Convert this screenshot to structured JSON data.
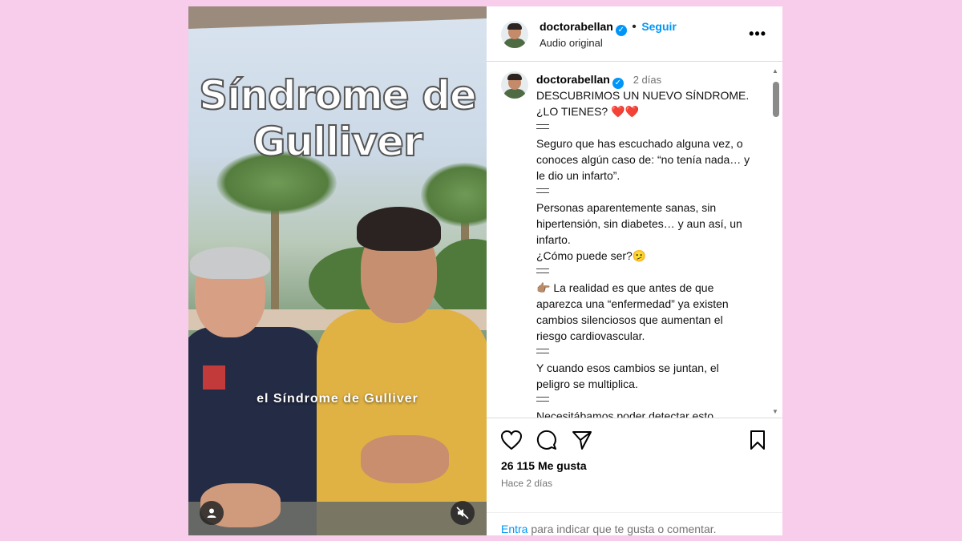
{
  "video": {
    "title_line1": "Síndrome de",
    "title_line2": "Gulliver",
    "caption": "el Síndrome de Gulliver"
  },
  "header": {
    "username": "doctorabellan",
    "follow_label": "Seguir",
    "audio": "Audio original"
  },
  "caption": {
    "username": "doctorabellan",
    "time": "2 días",
    "paragraphs": [
      "DESCUBRIMOS UN NUEVO SÍNDROME. ¿LO TIENES? ❤️❤️",
      "Seguro que has escuchado alguna vez, o conoces algún caso de: “no tenía nada… y le dio un infarto”.",
      "Personas aparentemente sanas, sin hipertensión, sin diabetes… y aun así, un infarto.",
      "¿Cómo puede ser?🫤",
      "👉🏽 La realidad es que antes de que aparezca una “enfermedad” ya existen cambios silenciosos que aumentan el riesgo cardiovascular.",
      "Y cuando esos cambios se juntan, el peligro se multiplica.",
      "Necesitábamos poder detectar esto"
    ]
  },
  "stats": {
    "likes": "26 115 Me gusta",
    "ago": "Hace 2 días"
  },
  "footer": {
    "login_link": "Entra",
    "rest": "para indicar que te gusta o comentar."
  },
  "colors": {
    "background": "#f8cdeb",
    "accent": "#0095f6"
  }
}
